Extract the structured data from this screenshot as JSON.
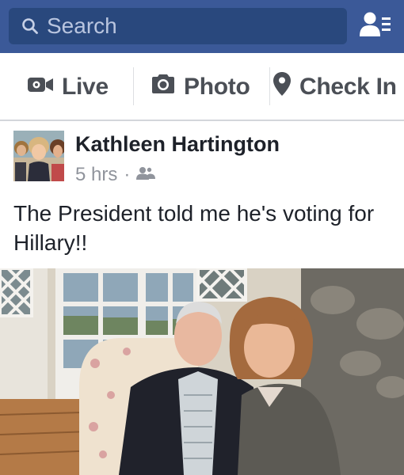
{
  "search": {
    "placeholder": "Search",
    "value": ""
  },
  "icons": {
    "search": "search-icon",
    "friends": "friend-requests-icon",
    "live": "video-camera-icon",
    "photo": "camera-icon",
    "checkin": "location-pin-icon",
    "audience": "friends-audience-icon"
  },
  "composer": {
    "live_label": "Live",
    "photo_label": "Photo",
    "checkin_label": "Check In"
  },
  "post": {
    "author": "Kathleen Hartington",
    "time": "5 hrs",
    "separator": "·",
    "text": "The President told me he's voting for Hillary!!"
  },
  "colors": {
    "brand": "#3b5998",
    "search_bg": "#29487d",
    "composer_text": "#4b4f56",
    "meta_text": "#90949c"
  }
}
